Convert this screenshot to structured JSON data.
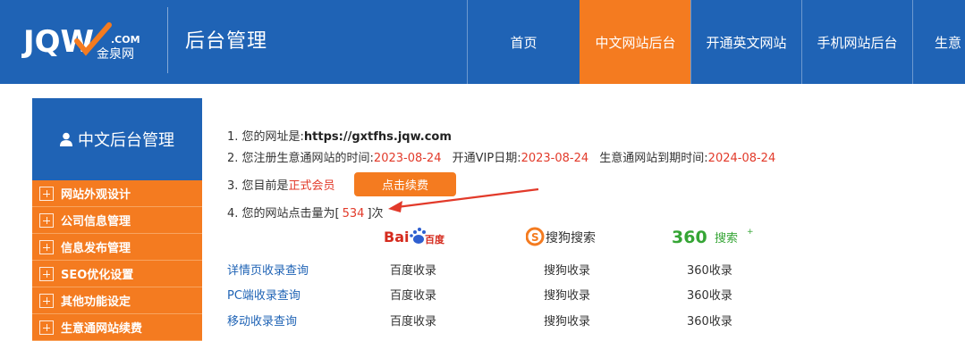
{
  "header": {
    "logo": {
      "text_main": "JQW",
      "text_com": ".COM",
      "text_cn": "金泉网"
    },
    "admin_title": "后台管理",
    "nav": [
      {
        "label": "首页",
        "active": false
      },
      {
        "label": "中文网站后台",
        "active": true
      },
      {
        "label": "开通英文网站",
        "active": false
      },
      {
        "label": "手机网站后台",
        "active": false
      },
      {
        "label": "生意",
        "active": false
      }
    ]
  },
  "sidebar": {
    "title": "中文后台管理",
    "items": [
      {
        "label": "网站外观设计"
      },
      {
        "label": "公司信息管理"
      },
      {
        "label": "信息发布管理"
      },
      {
        "label": "SEO优化设置"
      },
      {
        "label": "其他功能设定"
      },
      {
        "label": "生意通网站续费"
      }
    ]
  },
  "info": {
    "line1_label": "1. 您的网址是:",
    "line1_url": "https://gxtfhs.jqw.com",
    "line2_label": "2. 您注册生意通网站的时间:",
    "line2_register_date": "2023-08-24",
    "line2_vip_label": "开通VIP日期:",
    "line2_vip_date": "2023-08-24",
    "line2_expire_label": "生意通网站到期时间:",
    "line2_expire_date": "2024-08-24",
    "line3_label": "3. 您目前是",
    "line3_member": "正式会员",
    "renew_button": "点击续费",
    "line4_label": "4. 您的网站点击量为[",
    "line4_count": "534",
    "line4_suffix": "]次"
  },
  "engines": [
    {
      "name": "Bai百度",
      "icon": "baidu-logo-icon"
    },
    {
      "name": "搜狗搜索",
      "icon": "sogou-logo-icon"
    },
    {
      "name": "360搜索",
      "icon": "360-search-logo-icon"
    }
  ],
  "index_table": {
    "rows": [
      {
        "query": "详情页收录查询",
        "baidu": "百度收录",
        "sogou": "搜狗收录",
        "s360": "360收录"
      },
      {
        "query": "PC端收录查询",
        "baidu": "百度收录",
        "sogou": "搜狗收录",
        "s360": "360收录"
      },
      {
        "query": "移动收录查询",
        "baidu": "百度收录",
        "sogou": "搜狗收录",
        "s360": "360收录"
      }
    ]
  },
  "colors": {
    "brand_blue": "#1f63b5",
    "accent_orange": "#f47b20",
    "highlight_red": "#e23a2a",
    "link_blue": "#1f63b5"
  }
}
